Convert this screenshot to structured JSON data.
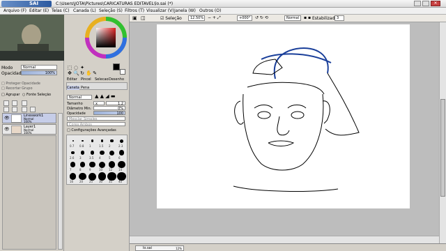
{
  "app": {
    "title": "C:\\Users\\JOTA\\Pictures\\CARICATURAS EDITAVEL\\lo.sai (*)",
    "logo_text": "SAI"
  },
  "menu": [
    "Arquivo (F)",
    "Editar (E)",
    "Telas (C)",
    "Canada (L)",
    "Seleção (S)",
    "Filtros (T)",
    "Visualizar (V)",
    "Janela (W)",
    "Outros (O)"
  ],
  "layer_panel": {
    "mode_label": "Modo",
    "mode_value": "Normal",
    "opacity_label": "Opacidade",
    "opacity_value": "100%",
    "group_label": "Agrupar",
    "source_label": "Fonte Seleção",
    "layers": [
      {
        "name": "Lineswork1",
        "mode": "Normal",
        "opacity": "100%"
      },
      {
        "name": "Layer1",
        "mode": "Normal",
        "opacity": "100%"
      }
    ]
  },
  "tool_panel": {
    "tabs": [
      "Editar",
      "Pincel",
      "Selecao",
      "Desenho"
    ],
    "sub_tabs": [
      "Caneta",
      "Pena"
    ],
    "mode_value": "Normal",
    "size_label": "Tamanho",
    "size_mult": "x 5.0",
    "size_value": "1.2",
    "min_label": "Diâmetro Min.",
    "min_value": "0%",
    "opacity_label": "Opacidade",
    "opacity_value": "100",
    "blend_label": "Mesclar Simples",
    "bleed_label": "Cores Ambos",
    "advanced_label": "Configurações Avançadas",
    "brush_sizes": [
      "0.7",
      "0.8",
      "1",
      "1.5",
      "2",
      "2.3",
      "2.6",
      "3",
      "3.5",
      "4",
      "5",
      "6",
      "7",
      "8",
      "9",
      "10",
      "12",
      "14",
      "16",
      "20",
      "25",
      "30",
      "35",
      "40"
    ],
    "selected_brush": "1.2"
  },
  "toolbar": {
    "selection_label": "Seleção",
    "zoom": "12.50%",
    "angle": "+000°",
    "mode": "Normal",
    "stabilizer_label": "Estabilizador",
    "stabilizer_value": "3"
  },
  "status": {
    "tab_label": "lo.sai",
    "tab_zoom": "12%"
  },
  "colors": {
    "accent": "#2c5aa0",
    "selected_layer": "#c6cde8",
    "foreground": "#000000",
    "background": "#ffffff"
  }
}
